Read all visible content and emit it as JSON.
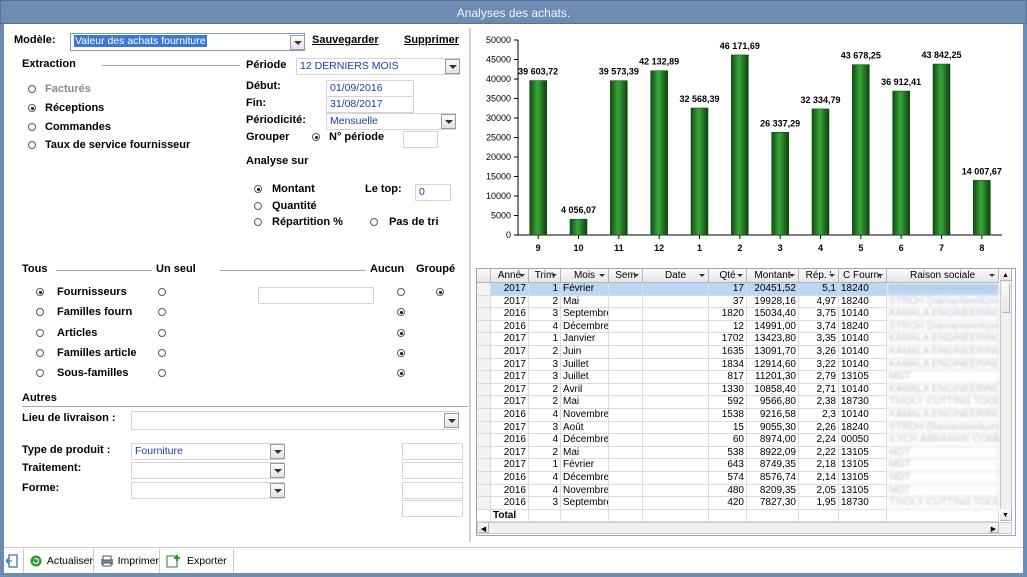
{
  "window": {
    "title": "Analyses des achats."
  },
  "toolbar": {
    "modele_label": "Modèle:",
    "modele_value": "Valeur des achats fourniture",
    "save_label": "Sauvegarder",
    "delete_label": "Supprimer"
  },
  "extraction": {
    "label": "Extraction",
    "options": [
      {
        "label": "Facturés",
        "checked": false,
        "disabled": true
      },
      {
        "label": "Réceptions",
        "checked": true
      },
      {
        "label": "Commandes",
        "checked": false
      },
      {
        "label": "Taux de service fournisseur",
        "checked": false
      }
    ]
  },
  "periode": {
    "label": "Période",
    "value": "12 DERNIERS MOIS",
    "debut_label": "Début:",
    "debut": "01/09/2016",
    "fin_label": "Fin:",
    "fin": "31/08/2017",
    "periodicite_label": "Périodicité:",
    "periodicite": "Mensuelle",
    "grouper_label": "Grouper",
    "grouper_option": "N° période"
  },
  "analyse": {
    "label": "Analyse sur",
    "montant": "Montant",
    "quantite": "Quantité",
    "repartition": "Répartition %",
    "top_label": "Le top:",
    "top_value": "0",
    "pas_de_tri": "Pas de tri"
  },
  "selection": {
    "tous": "Tous",
    "un_seul": "Un seul",
    "aucun": "Aucun",
    "groupe": "Groupé",
    "rows": [
      "Fournisseurs",
      "Familles fourn",
      "Articles",
      "Familles article",
      "Sous-familles"
    ]
  },
  "autres": {
    "label": "Autres",
    "lieu_label": "Lieu de livraison :",
    "type_label": "Type de produit :",
    "type_value": "Fourniture",
    "traitement_label": "Traitement:",
    "forme_label": "Forme:"
  },
  "buttons": {
    "actualiser": "Actualiser",
    "imprimer": "Imprimer",
    "exporter": "Exporter"
  },
  "chart_data": {
    "type": "bar",
    "categories": [
      "9",
      "10",
      "11",
      "12",
      "1",
      "2",
      "3",
      "4",
      "5",
      "6",
      "7",
      "8"
    ],
    "values": [
      39603.72,
      4056.07,
      39573.39,
      42132.89,
      32568.39,
      46171.69,
      26337.29,
      32334.79,
      43678.25,
      36912.41,
      43842.25,
      14007.67
    ],
    "labels": [
      "39 603,72",
      "4 056,07",
      "39 573,39",
      "42 132,89",
      "32 568,39",
      "46 171,69",
      "26 337,29",
      "32 334,79",
      "43 678,25",
      "36 912,41",
      "43 842,25",
      "14 007,67"
    ],
    "ylim": [
      0,
      50000
    ],
    "yticks": [
      "0",
      "5000",
      "10000",
      "15000",
      "20000",
      "25000",
      "30000",
      "35000",
      "40000",
      "45000",
      "50000"
    ],
    "color": "#1f7a1f"
  },
  "table": {
    "columns": [
      "Anné",
      "Trim",
      "Mois",
      "Sem",
      "Date",
      "Qté",
      "Montant",
      "Rép. '",
      "C Fourn.",
      "Raison sociale"
    ],
    "rows": [
      [
        "2017",
        "1",
        "Février",
        "",
        "",
        "17",
        "20451,52",
        "5,1",
        "18240",
        "STROH Diamantwerkzeuge"
      ],
      [
        "2017",
        "2",
        "Mai",
        "",
        "",
        "37",
        "19928,16",
        "4,97",
        "18240",
        "STROH Diamantwerkzeuge"
      ],
      [
        "2016",
        "3",
        "Septembre",
        "",
        "",
        "1820",
        "15034,40",
        "3,75",
        "10140",
        "KAMALA ENGINEERING"
      ],
      [
        "2016",
        "4",
        "Décembre",
        "",
        "",
        "12",
        "14991,00",
        "3,74",
        "18240",
        "STROH Diamantwerkzeuge"
      ],
      [
        "2017",
        "1",
        "Janvier",
        "",
        "",
        "1702",
        "13423,80",
        "3,35",
        "10140",
        "KAMALA ENGINEERING"
      ],
      [
        "2017",
        "2",
        "Juin",
        "",
        "",
        "1635",
        "13091,70",
        "3,26",
        "10140",
        "KAMALA ENGINEERING"
      ],
      [
        "2017",
        "3",
        "Juillet",
        "",
        "",
        "1834",
        "12914,60",
        "3,22",
        "10140",
        "KAMALA ENGINEERING"
      ],
      [
        "2017",
        "3",
        "Juillet",
        "",
        "",
        "817",
        "11201,30",
        "2,79",
        "13105",
        "MDT"
      ],
      [
        "2017",
        "2",
        "Avril",
        "",
        "",
        "1330",
        "10858,40",
        "2,71",
        "10140",
        "KAMALA ENGINEERING"
      ],
      [
        "2017",
        "2",
        "Mai",
        "",
        "",
        "592",
        "9566,80",
        "2,38",
        "18730",
        "TIVOLY CUTTING TOOLS"
      ],
      [
        "2016",
        "4",
        "Novembre",
        "",
        "",
        "1538",
        "9216,58",
        "2,3",
        "10140",
        "KAMALA ENGINEERING"
      ],
      [
        "2017",
        "3",
        "Août",
        "",
        "",
        "15",
        "9055,30",
        "2,26",
        "18240",
        "STROH Diamantwerkzeuge"
      ],
      [
        "2016",
        "4",
        "Décembre",
        "",
        "",
        "60",
        "8974,00",
        "2,24",
        "00050",
        "ILYCH ABRASIVE COMPANY"
      ],
      [
        "2017",
        "2",
        "Mai",
        "",
        "",
        "538",
        "8922,09",
        "2,22",
        "13105",
        "MDT"
      ],
      [
        "2017",
        "1",
        "Février",
        "",
        "",
        "643",
        "8749,35",
        "2,18",
        "13105",
        "MDT"
      ],
      [
        "2016",
        "4",
        "Décembre",
        "",
        "",
        "574",
        "8576,74",
        "2,14",
        "13105",
        "MDT"
      ],
      [
        "2016",
        "4",
        "Novembre",
        "",
        "",
        "480",
        "8209,35",
        "2,05",
        "13105",
        "MDT"
      ],
      [
        "2016",
        "3",
        "Septembre",
        "",
        "",
        "420",
        "7827,30",
        "1,95",
        "18730",
        "TIVOLY CUTTING TOOLS"
      ]
    ],
    "total_label": "Total"
  }
}
